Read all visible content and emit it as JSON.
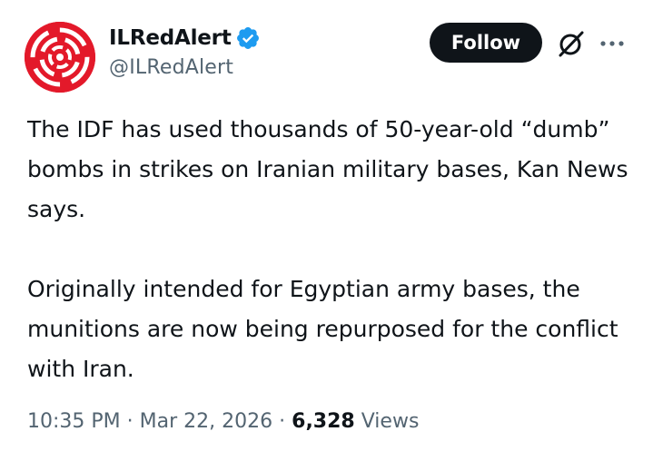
{
  "author": {
    "display_name": "ILRedAlert",
    "handle": "@ILRedAlert",
    "verified": true,
    "avatar_icon": "siren-logo-icon",
    "avatar_color": "#e3192a"
  },
  "actions": {
    "follow_label": "Follow",
    "grok_icon": "grok-icon",
    "more_icon": "more-icon"
  },
  "tweet": {
    "paragraphs": [
      "The IDF has used thousands of 50-year-old “dumb” bombs in strikes on Iranian military bases, Kan News says.",
      "Originally intended for Egyptian army bases, the munitions are now being repurposed for the conflict with Iran."
    ]
  },
  "meta": {
    "time": "10:35 PM",
    "separator": "·",
    "date": "Mar 22, 2026",
    "views_count": "6,328",
    "views_label": "Views"
  },
  "colors": {
    "verified_badge": "#1d9bf0",
    "follow_button_bg": "#0f1419",
    "secondary_text": "#536471"
  }
}
